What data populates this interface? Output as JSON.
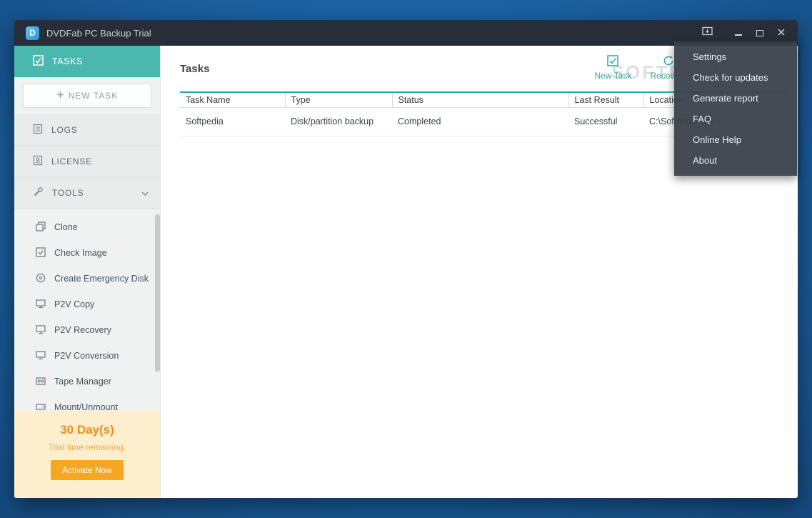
{
  "titlebar": {
    "title": "DVDFab PC Backup Trial",
    "logo_letter": "D"
  },
  "sidebar": {
    "tasks_label": "TASKS",
    "new_task_label": "NEW TASK",
    "groups": [
      {
        "label": "LOGS"
      },
      {
        "label": "LICENSE"
      },
      {
        "label": "TOOLS"
      }
    ],
    "tools": [
      {
        "label": "Clone"
      },
      {
        "label": "Check Image"
      },
      {
        "label": "Create Emergency Disk"
      },
      {
        "label": "P2V Copy"
      },
      {
        "label": "P2V Recovery"
      },
      {
        "label": "P2V Conversion"
      },
      {
        "label": "Tape Manager"
      },
      {
        "label": "Mount/Unmount"
      }
    ],
    "trial": {
      "days": "30 Day(s)",
      "note": "Trial time remaining.",
      "button": "Activate Now"
    }
  },
  "main": {
    "title": "Tasks",
    "actions": {
      "new_task": "New Task",
      "recovery": "Recovery"
    },
    "watermark": "SOFTPEDIA",
    "watermark_mark": "®",
    "table": {
      "columns": [
        "Task Name",
        "Type",
        "Status",
        "Last Result",
        "Location"
      ],
      "rows": [
        {
          "task_name": "Softpedia",
          "type": "Disk/partition backup",
          "status": "Completed",
          "last_result": "Successful",
          "location": "C:\\Softpedia Tes..."
        }
      ]
    }
  },
  "menu": {
    "items": [
      "Settings",
      "Check for updates",
      "Generate report",
      "FAQ",
      "Online Help",
      "About"
    ]
  },
  "colors": {
    "accent_teal": "#2fa8a0",
    "active_item_teal": "#4bb8af",
    "trial_orange": "#f5a623",
    "titlebar_dark": "#262e37"
  }
}
